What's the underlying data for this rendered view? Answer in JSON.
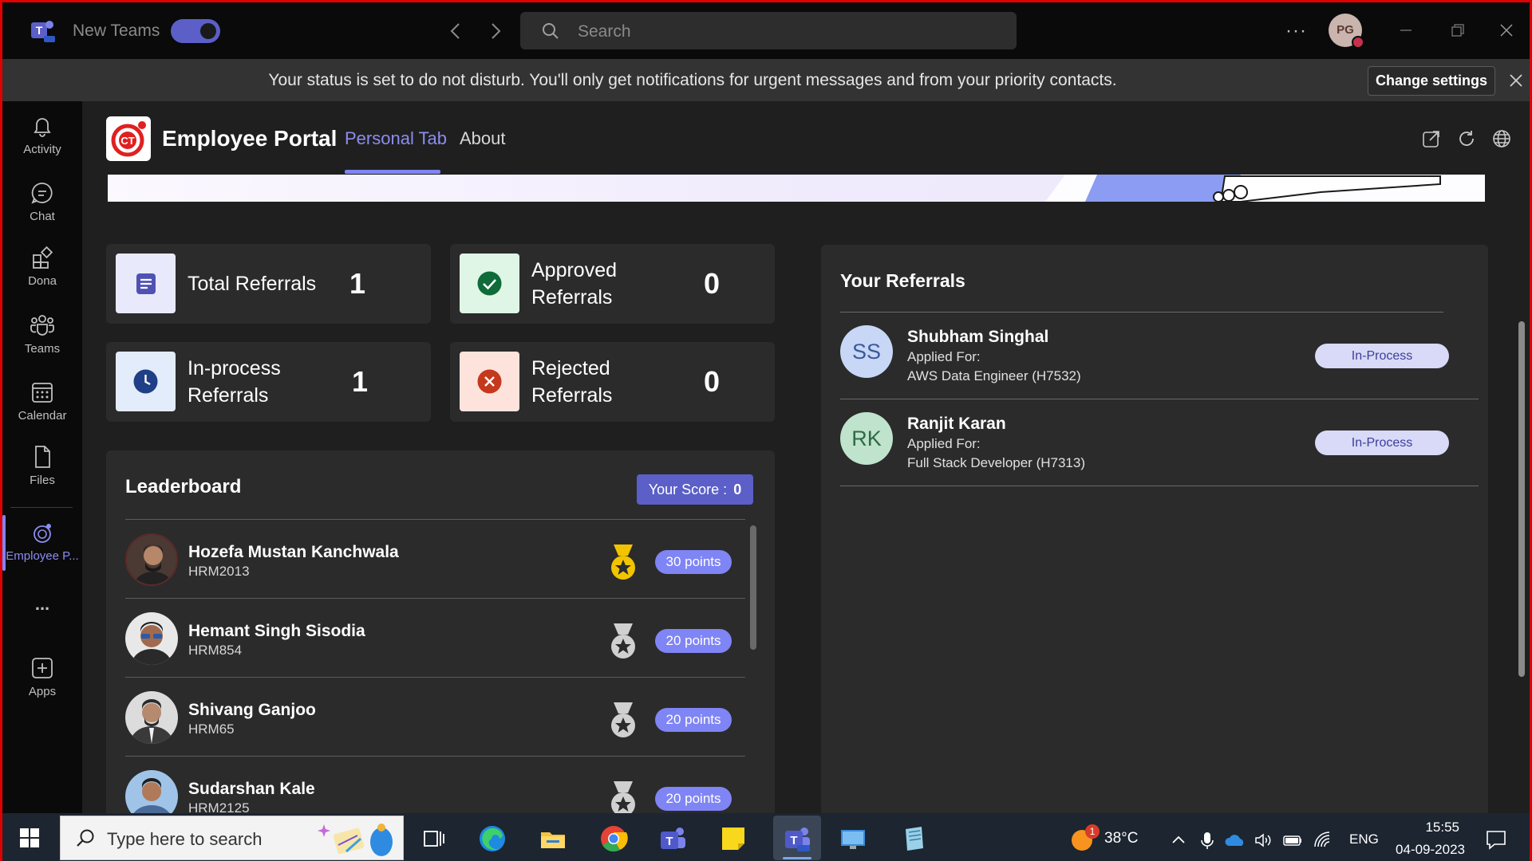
{
  "titlebar": {
    "app_title": "New Teams",
    "search_placeholder": "Search",
    "more_label": "···",
    "avatar_initials": "PG"
  },
  "dnd_banner": {
    "message": "Your status is set to do not disturb. You'll only get notifications for urgent messages and from your priority contacts.",
    "button_label": "Change settings"
  },
  "rail": {
    "items": [
      {
        "label": "Activity",
        "icon": "bell-icon"
      },
      {
        "label": "Chat",
        "icon": "chat-icon"
      },
      {
        "label": "Dona",
        "icon": "apps-grid-icon"
      },
      {
        "label": "Teams",
        "icon": "teams-icon"
      },
      {
        "label": "Calendar",
        "icon": "calendar-icon"
      },
      {
        "label": "Files",
        "icon": "file-icon"
      },
      {
        "label": "Employee P...",
        "icon": "employee-portal-icon"
      },
      {
        "label": "...",
        "icon": "more-icon"
      },
      {
        "label": "Apps",
        "icon": "add-app-icon"
      }
    ]
  },
  "app": {
    "title": "Employee Portal",
    "tabs": [
      {
        "label": "Personal Tab",
        "active": true
      },
      {
        "label": "About",
        "active": false
      }
    ]
  },
  "stats": [
    {
      "label": "Total Referrals",
      "value": "1",
      "icon": "document-icon",
      "icon_bg": "#e8eafc",
      "icon_color": "#4f52b2"
    },
    {
      "label": "Approved Referrals",
      "value": "0",
      "icon": "check-circle-icon",
      "icon_bg": "#dff6e6",
      "icon_color": "#0f6b3a"
    },
    {
      "label": "In-process Referrals",
      "value": "1",
      "icon": "clock-icon",
      "icon_bg": "#e3ecfb",
      "icon_color": "#1f3f86"
    },
    {
      "label": "Rejected Referrals",
      "value": "0",
      "icon": "x-circle-icon",
      "icon_bg": "#fde3dc",
      "icon_color": "#c4391d"
    }
  ],
  "leaderboard": {
    "title": "Leaderboard",
    "score_label": "Your Score :",
    "score_value": "0",
    "rows": [
      {
        "name": "Hozefa Mustan Kanchwala",
        "id": "HRM2013",
        "points": "30 points",
        "medal": "gold"
      },
      {
        "name": "Hemant Singh Sisodia",
        "id": "HRM854",
        "points": "20 points",
        "medal": "silver"
      },
      {
        "name": "Shivang Ganjoo",
        "id": "HRM65",
        "points": "20 points",
        "medal": "silver"
      },
      {
        "name": "Sudarshan Kale",
        "id": "HRM2125",
        "points": "20 points",
        "medal": "silver"
      }
    ]
  },
  "referrals": {
    "title": "Your Referrals",
    "items": [
      {
        "initials": "SS",
        "name": "Shubham Singhal",
        "applied_label": "Applied For:",
        "role": "AWS Data Engineer (H7532)",
        "status": "In-Process",
        "avatar_bg": "#c7d7f5",
        "avatar_fg": "#3b5a9a"
      },
      {
        "initials": "RK",
        "name": "Ranjit Karan",
        "applied_label": "Applied For:",
        "role": "Full Stack Developer (H7313)",
        "status": "In-Process",
        "avatar_bg": "#bfe3cc",
        "avatar_fg": "#2f6b47"
      }
    ]
  },
  "taskbar": {
    "search_placeholder": "Type here to search",
    "temperature": "38°C",
    "weather_badge": "1",
    "language": "ENG",
    "time": "15:55",
    "date": "04-09-2023"
  },
  "colors": {
    "accent": "#7f85f5",
    "accent_dark": "#5b5fc7",
    "dnd": "#c4314b",
    "gold": "#f2c400",
    "silver": "#d0d0d0"
  }
}
